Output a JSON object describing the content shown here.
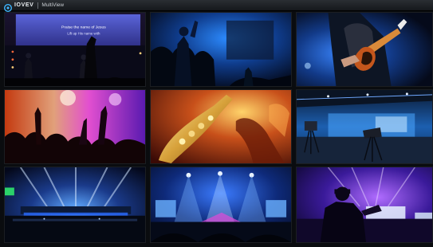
{
  "titlebar": {
    "brand": "IOVEV",
    "app_title": "MultiView",
    "logo_icon": "brand-logo-icon"
  },
  "tiles": [
    {
      "id": 1,
      "row": 1,
      "col": 1,
      "scene": "stage-band-lyrics-screen",
      "overlay_text": "Praise the name of Jesus"
    },
    {
      "id": 2,
      "row": 1,
      "col": 2,
      "scene": "crowd-silhouettes-blue-lights",
      "overlay_text": ""
    },
    {
      "id": 3,
      "row": 1,
      "col": 3,
      "scene": "guitarist-closeup",
      "overlay_text": ""
    },
    {
      "id": 4,
      "row": 2,
      "col": 1,
      "scene": "crowd-hands-raised-colorful",
      "overlay_text": ""
    },
    {
      "id": 5,
      "row": 2,
      "col": 2,
      "scene": "saxophone-closeup",
      "overlay_text": ""
    },
    {
      "id": 6,
      "row": 2,
      "col": 3,
      "scene": "tv-studio-cameras",
      "overlay_text": ""
    },
    {
      "id": 7,
      "row": 3,
      "col": 1,
      "scene": "arena-stage-lights",
      "overlay_text": ""
    },
    {
      "id": 8,
      "row": 3,
      "col": 2,
      "scene": "concert-stage-screens",
      "overlay_text": ""
    },
    {
      "id": 9,
      "row": 3,
      "col": 3,
      "scene": "camera-operator-purple-stage",
      "overlay_text": ""
    }
  ],
  "colors": {
    "titlebar": "#1e2226",
    "tile_border": "#1b1e22",
    "brand_text": "#e9edf1"
  }
}
